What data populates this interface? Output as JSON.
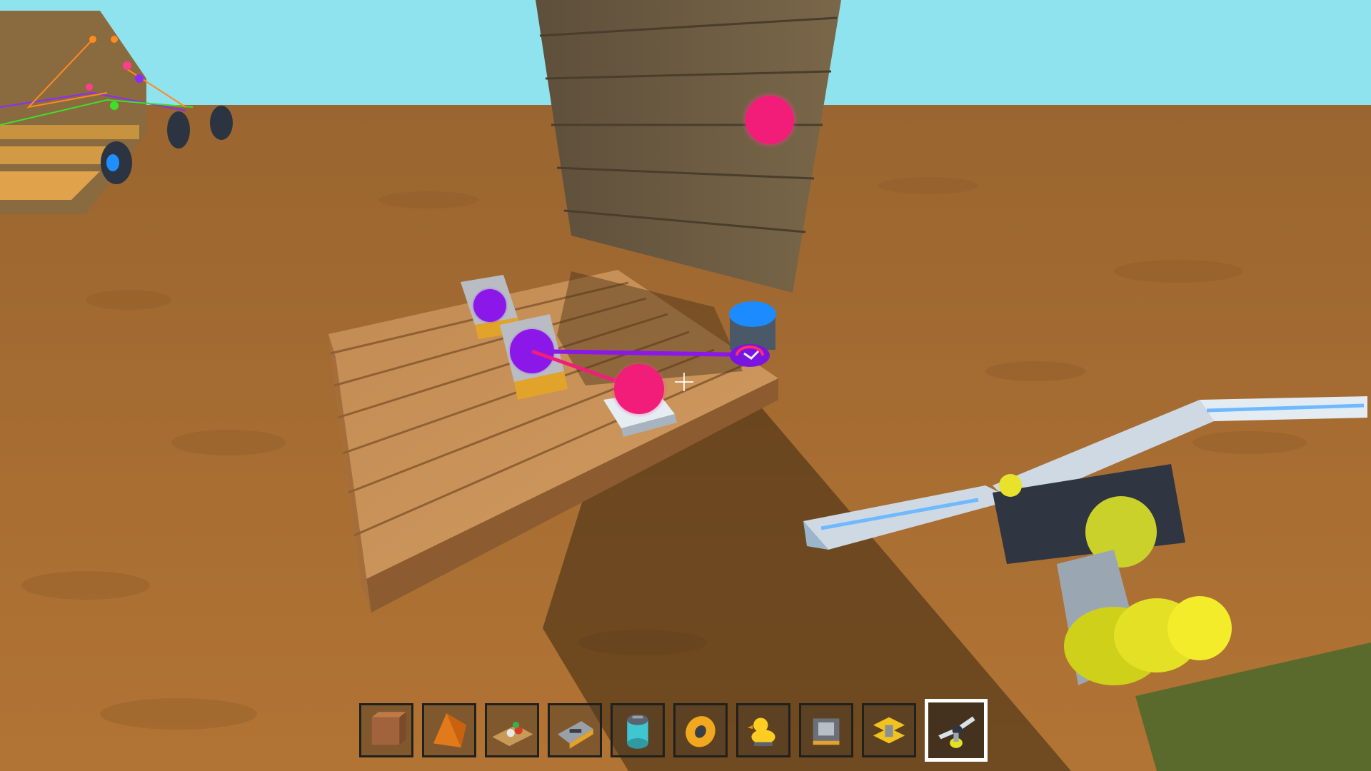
{
  "game": {
    "colors": {
      "sky": "#8fe3ee",
      "ground": "#a86a2c",
      "plank": "#c9915a",
      "wall": "#6b5a43",
      "link_purple": "#8b18e8",
      "link_pink": "#f21d78",
      "link_blue": "#1b8bff"
    }
  },
  "hud": {
    "selected_slot": 9,
    "hotbar": [
      {
        "icon": "wood-block-icon",
        "color": "#a0633b"
      },
      {
        "icon": "orange-wedge-icon",
        "color": "#e07a1b"
      },
      {
        "icon": "button-panel-icon",
        "color": "#c89a57"
      },
      {
        "icon": "switch-block-icon",
        "color": "#9aa0a8"
      },
      {
        "icon": "canister-icon",
        "color": "#3fc6d0"
      },
      {
        "icon": "bearing-icon",
        "color": "#f2a81e"
      },
      {
        "icon": "duck-icon",
        "color": "#ffcc22"
      },
      {
        "icon": "engine-block-icon",
        "color": "#6a6f78"
      },
      {
        "icon": "yellow-tool-block-icon",
        "color": "#f2c21e"
      },
      {
        "icon": "connect-tool-icon",
        "color": "#d9e2ea"
      }
    ]
  }
}
